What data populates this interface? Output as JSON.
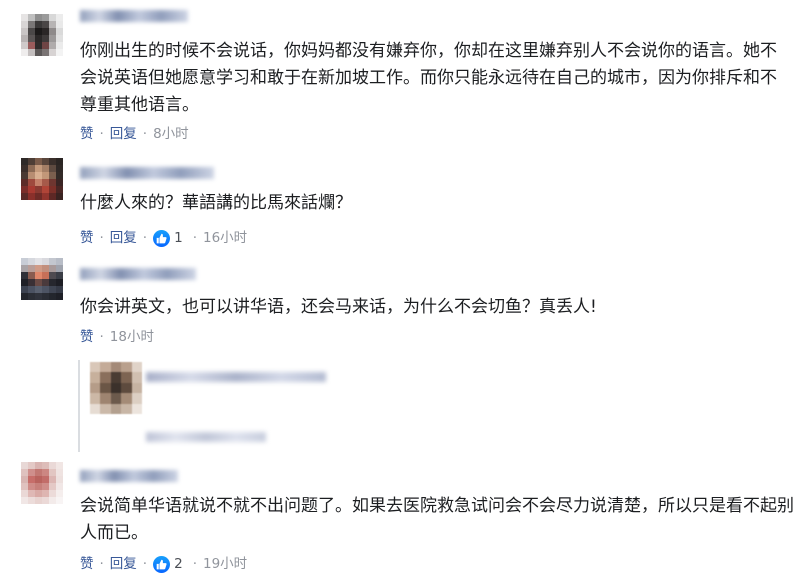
{
  "comments": [
    {
      "text": "你刚出生的时候不会说话，你妈妈都没有嫌弃你，你却在这里嫌弃别人不会说你的语言。她不会说英语但她愿意学习和敢于在新加坡工作。而你只能永远待在自己的城市，因为你排斥和不尊重其他语言。",
      "like_label": "赞",
      "reply_label": "回复",
      "time": "8小时",
      "like_count": ""
    },
    {
      "text": "什麼人來的？華語講的比馬來話爛？",
      "like_label": "赞",
      "reply_label": "回复",
      "time": "16小时",
      "like_count": "1"
    },
    {
      "text": "你会讲英文，也可以讲华语，还会马来话，为什么不会切鱼？真丢人!",
      "like_label": "赞",
      "reply_label": "回复",
      "time": "18小时",
      "like_count": ""
    },
    {
      "text": "会说简单华语就说不就不出问题了。如果去医院救急试问会不会尽力说清楚，所以只是看不起别人而已。",
      "like_label": "赞",
      "reply_label": "回复",
      "time": "19小时",
      "like_count": "2"
    }
  ],
  "separator": "·",
  "colors": {
    "link": "#385898",
    "meta": "#90949c",
    "text": "#1c1e21",
    "like_blue": "#0866ff"
  },
  "icons": {
    "like": "thumbs-up-icon"
  }
}
